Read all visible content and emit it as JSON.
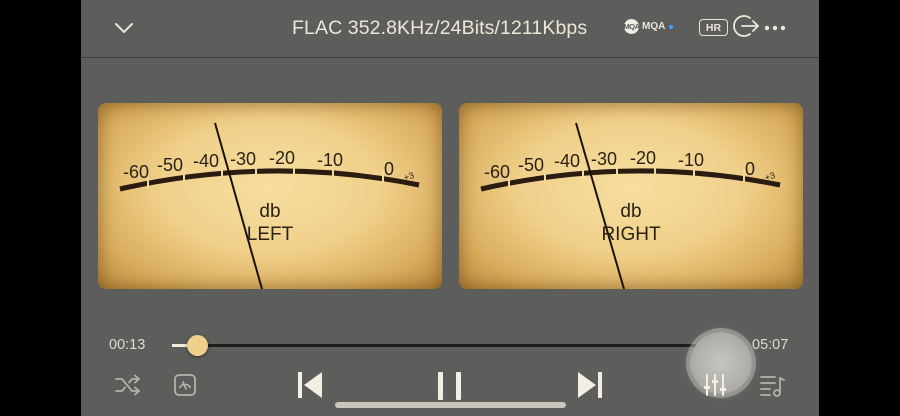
{
  "header": {
    "format_text": "FLAC 352.8KHz/24Bits/1211Kbps",
    "mqa_label": "MQA",
    "mqa_circle": "MQA",
    "hr_badge": "HR"
  },
  "meters": {
    "scale_labels": [
      "-60",
      "-50",
      "-40",
      "-30",
      "-20",
      "-10",
      "0",
      "+3"
    ],
    "unit": "db",
    "left_label": "LEFT",
    "right_label": "RIGHT"
  },
  "playback": {
    "elapsed": "00:13",
    "total": "05:07",
    "progress_fraction": 0.042
  },
  "icons": {
    "collapse": "chevron-down-icon",
    "exit": "exit-icon",
    "more": "more-icon",
    "shuffle": "shuffle-icon",
    "gauge": "gauge-icon",
    "previous": "skip-previous-icon",
    "pause": "pause-icon",
    "next": "skip-next-icon",
    "equalizer": "equalizer-icon",
    "playlist": "playlist-icon"
  },
  "colors": {
    "screen_bg": "#5d5d5b",
    "meter_face": "#f0d08a",
    "accent_thumb": "#eecf8c",
    "text_light": "#ece7d6"
  }
}
